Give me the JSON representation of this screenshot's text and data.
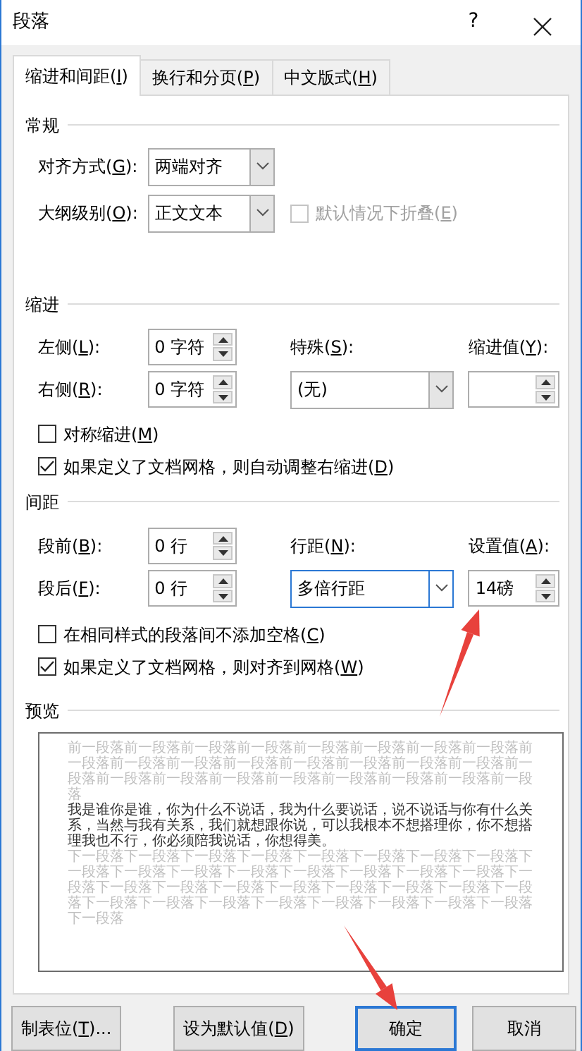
{
  "window": {
    "title": "段落",
    "help": "?"
  },
  "tabs": [
    {
      "label": "缩进和间距(I)",
      "selected": true
    },
    {
      "label": "换行和分页(P)",
      "selected": false
    },
    {
      "label": "中文版式(H)",
      "selected": false
    }
  ],
  "general": {
    "heading": "常规",
    "alignment": {
      "label": "对齐方式(G):",
      "value": "两端对齐"
    },
    "outline_level": {
      "label": "大纲级别(O):",
      "value": "正文文本"
    },
    "collapse": {
      "label": "默认情况下折叠(E)",
      "checked": false,
      "disabled": true
    }
  },
  "indentation": {
    "heading": "缩进",
    "left": {
      "label": "左侧(L):",
      "value": "0 字符"
    },
    "right": {
      "label": "右侧(R):",
      "value": "0 字符"
    },
    "special": {
      "label": "特殊(S):",
      "value": "(无)"
    },
    "by": {
      "label": "缩进值(Y):"
    },
    "mirror": {
      "label": "对称缩进(M)",
      "checked": false
    },
    "auto_adjust": {
      "label": "如果定义了文档网格，则自动调整右缩进(D)",
      "checked": true
    }
  },
  "spacing": {
    "heading": "间距",
    "before": {
      "label": "段前(B):",
      "value": "0 行"
    },
    "after": {
      "label": "段后(F):",
      "value": "0 行"
    },
    "line_spacing": {
      "label": "行距(N):",
      "value": "多倍行距",
      "focused": true
    },
    "at": {
      "label": "设置值(A):",
      "value": "14磅"
    },
    "no_space": {
      "label": "在相同样式的段落间不添加空格(C)",
      "checked": false
    },
    "snap": {
      "label": "如果定义了文档网格，则对齐到网格(W)",
      "checked": true
    }
  },
  "preview": {
    "heading": "预览",
    "previous_text": "前一段落前一段落前一段落前一段落前一段落前一段落前一段落前一段落前一段落前一段落前一段落前一段落前一段落前一段落前一段落前一段落前一段落前一段落前一段落前一段落前一段落前一段落前一段落前一段落前一段落",
    "sample_text": "我是谁你是谁，你为什么不说话，我为什么要说话，说不说话与你有什么关系，当然与我有关系，我们就想跟你说，可以我根本不想搭理你，你不想搭理我也不行，你必须陪我说话，你想得美。",
    "next_text": "下一段落下一段落下一段落下一段落下一段落下一段落下一段落下一段落下一段落下一段落下一段落下一段落下一段落下一段落下一段落下一段落下一段落下一段落下一段落下一段落下一段落下一段落下一段落下一段落下一段落下一段落下一段落下一段落下一段落下一段落下一段落下一段落下一段落下一段落"
  },
  "buttons": [
    {
      "label": "制表位(T)...",
      "default": false
    },
    {
      "label": "设为默认值(D)",
      "default": false
    },
    {
      "label": "确定",
      "default": true
    },
    {
      "label": "取消",
      "default": false
    }
  ],
  "annotations": [
    {
      "kind": "arrow"
    },
    {
      "kind": "arrow"
    }
  ]
}
